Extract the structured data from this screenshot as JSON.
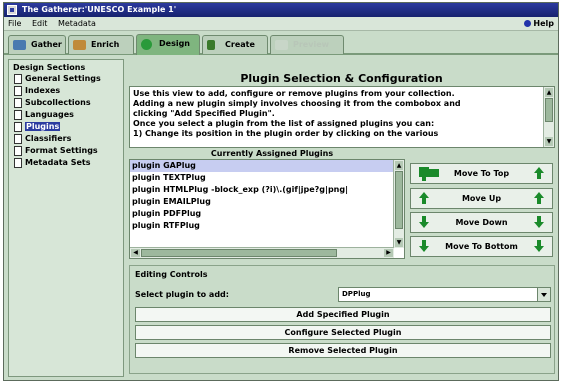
{
  "window": {
    "title": "The Gatherer:'UNESCO Example 1'"
  },
  "menu": {
    "items": [
      "File",
      "Edit",
      "Metadata"
    ],
    "help": "Help"
  },
  "tabs": [
    {
      "label": "Gather",
      "color": "#4a7ab0"
    },
    {
      "label": "Enrich",
      "color": "#c08a3a"
    },
    {
      "label": "Design",
      "color": "#2a9a3a"
    },
    {
      "label": "Create",
      "color": "#3a7a2a"
    },
    {
      "label": "Preview",
      "color": "#c8d6c8"
    }
  ],
  "sidebar": {
    "title": "Design Sections",
    "items": [
      "General Settings",
      "Indexes",
      "Subcollections",
      "Languages",
      "Plugins",
      "Classifiers",
      "Format Settings",
      "Metadata Sets"
    ],
    "selected": "Plugins"
  },
  "main": {
    "title": "Plugin Selection & Configuration",
    "description": [
      "Use this view to add, configure or remove plugins from your collection.",
      "Adding a new plugin simply involves choosing it from the combobox and",
      "clicking \"Add Specified Plugin\".",
      "Once you select a plugin from the list of assigned plugins you can:",
      "1)  Change its position in the plugin order by clicking on the various"
    ],
    "assigned_label": "Currently Assigned Plugins",
    "plugins": [
      "plugin GAPlug",
      "plugin TEXTPlug",
      "plugin HTMLPlug -block_exp (?i)\\.(gif|jpe?g|png|",
      "plugin EMAILPlug",
      "plugin PDFPlug",
      "plugin RTFPlug"
    ],
    "move_buttons": [
      "Move To Top",
      "Move Up",
      "Move Down",
      "Move To Bottom"
    ],
    "editing": {
      "title": "Editing Controls",
      "select_label": "Select plugin to add:",
      "select_value": "DPPlug",
      "add_button": "Add Specified Plugin",
      "configure_button": "Configure Selected Plugin",
      "remove_button": "Remove Selected Plugin"
    }
  }
}
